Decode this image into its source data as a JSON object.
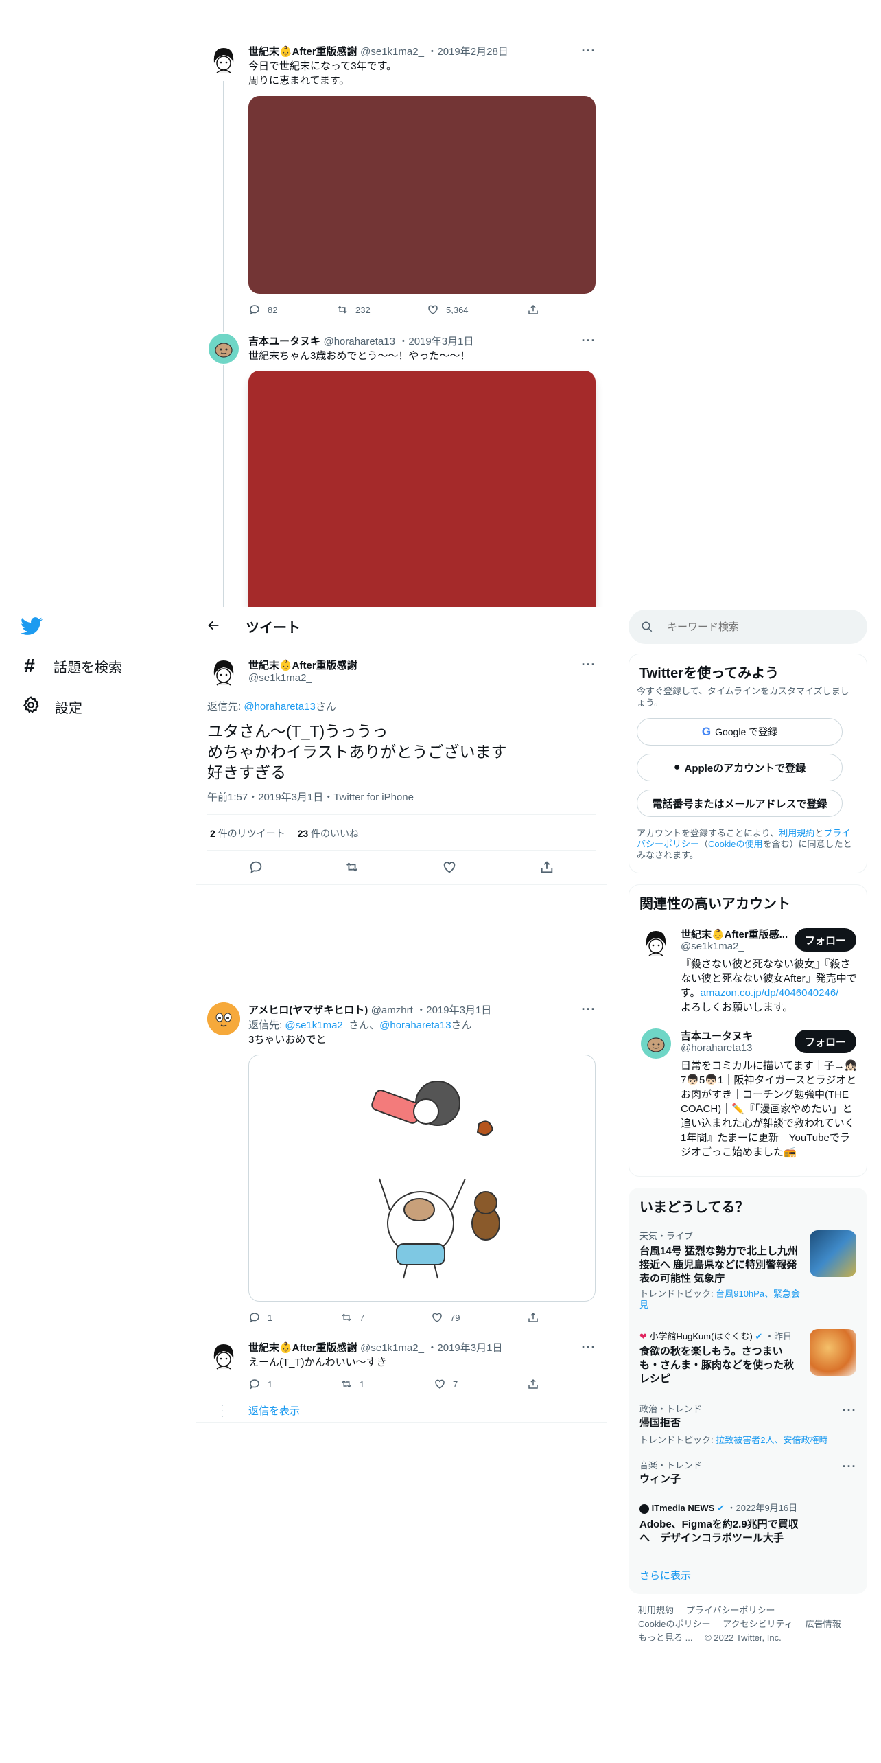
{
  "nav": {
    "explore_label": "話題を検索",
    "settings_label": "設定"
  },
  "header": {
    "title": "ツイート"
  },
  "thread": [
    {
      "name": "世紀末👶After重版感謝",
      "handle": "@se1k1ma2_",
      "date": "2019年2月28日",
      "text": "今日で世紀末になって3年です。\n周りに恵まれてます。",
      "media_color": "#733535",
      "reply_count": "82",
      "retweet_count": "232",
      "like_count": "5,364"
    },
    {
      "name": "吉本ユータヌキ",
      "handle": "@horahareta13",
      "date": "2019年3月1日",
      "text": "世紀末ちゃん3歳おめでとう〜〜！やった〜〜！",
      "media_color": "#a52a2a"
    }
  ],
  "main_tweet": {
    "name": "世紀末👶After重版感謝",
    "handle": "@se1k1ma2_",
    "reply_to_prefix": "返信先: ",
    "reply_to_handle": "@horahareta13",
    "reply_to_suffix": "さん",
    "text_line1": "ユタさん〜(T_T)うっうっ",
    "text_line2": "めちゃかわイラストありがとうございます",
    "text_line3": "好きすぎる",
    "timestamp": "午前1:57・2019年3月1日・Twitter for iPhone",
    "retweets_num": "2",
    "retweets_label": "件のリツイート",
    "likes_num": "23",
    "likes_label": "件のいいね"
  },
  "replies": [
    {
      "name": "アメヒロ(ヤマザキヒロト)",
      "handle": "@amzhrt",
      "date": "2019年3月1日",
      "reply_prefix": "返信先: ",
      "reply_handle1": "@se1k1ma2_",
      "reply_mid": "さん、",
      "reply_handle2": "@horahareta13",
      "reply_suffix": "さん",
      "text": "3ちゃいおめでと",
      "reply_count": "1",
      "retweet_count": "7",
      "like_count": "79"
    },
    {
      "name": "世紀末👶After重版感謝",
      "handle": "@se1k1ma2_",
      "date": "2019年3月1日",
      "text": "えーん(T_T)かんわいい〜すき",
      "reply_count": "1",
      "retweet_count": "1",
      "like_count": "7",
      "show_replies": "返信を表示"
    }
  ],
  "search": {
    "placeholder": "キーワード検索"
  },
  "signup": {
    "title": "Twitterを使ってみよう",
    "subtitle": "今すぐ登録して、タイムラインをカスタマイズしましょう。",
    "google_label": "Google で登録",
    "apple_label": "Appleのアカウントで登録",
    "phone_label": "電話番号またはメールアドレスで登録",
    "legal_1": "アカウントを登録することにより、",
    "legal_terms": "利用規約",
    "legal_and": "と",
    "legal_privacy": "プライバシーポリシー",
    "legal_paren": "（",
    "legal_cookie": "Cookieの使用",
    "legal_2": "を含む）に同意したとみなされます。"
  },
  "relevant": {
    "title": "関連性の高いアカウント",
    "follow_label": "フォロー",
    "accounts": [
      {
        "name": "世紀末👶After重版感...",
        "handle": "@se1k1ma2_",
        "bio_1": "『殺さない彼と死なない彼女』『殺さない彼と死なない彼女After』発売中です。",
        "bio_link": "amazon.co.jp/dp/4046040246/",
        "bio_2": "よろしくお願いします。"
      },
      {
        "name": "吉本ユータヌキ",
        "handle": "@horahareta13",
        "bio": "日常をコミカルに描いてます｜子→👧🏻7👦🏻5👦🏻1｜阪神タイガースとラジオとお肉がすき｜コーチング勉強中(THE COACH)｜✏️『「漫画家やめたい」と追い込まれた心が雑談で救われていく1年間』たまーに更新｜YouTubeでラジオごっこ始めました📻"
      }
    ]
  },
  "trends": {
    "title": "いまどうしてる？",
    "items": [
      {
        "category": "天気・ライブ",
        "title": "台風14号 猛烈な勢力で北上し九州接近へ 鹿児島県などに特別警報発表の可能性 気象庁",
        "topic_prefix": "トレンドトピック: ",
        "topic": "台風910hPa、緊急会見"
      },
      {
        "account": "小学館HugKum(はぐくむ)",
        "time": "・昨日",
        "title": "食欲の秋を楽しもう。さつまいも・さんま・豚肉などを使った秋レシピ"
      },
      {
        "category": "政治・トレンド",
        "title": "帰国拒否",
        "topic_prefix": "トレンドトピック: ",
        "topic": "拉致被害者2人、安倍政権時"
      },
      {
        "category": "音楽・トレンド",
        "title": "ウィン子"
      },
      {
        "account": "ITmedia NEWS",
        "time": "・2022年9月16日",
        "title": "Adobe、Figmaを約2.9兆円で買収へ　デザインコラボツール大手"
      }
    ],
    "show_more": "さらに表示"
  },
  "footer": {
    "terms": "利用規約",
    "privacy": "プライバシーポリシー",
    "cookie": "Cookieのポリシー",
    "accessibility": "アクセシビリティ",
    "ads": "広告情報",
    "more": "もっと見る ...",
    "copyright": "© 2022 Twitter, Inc."
  },
  "colors": {
    "accent": "#1d9bf0",
    "text": "#0f1419",
    "muted": "#536471",
    "border": "#eff3f4"
  }
}
